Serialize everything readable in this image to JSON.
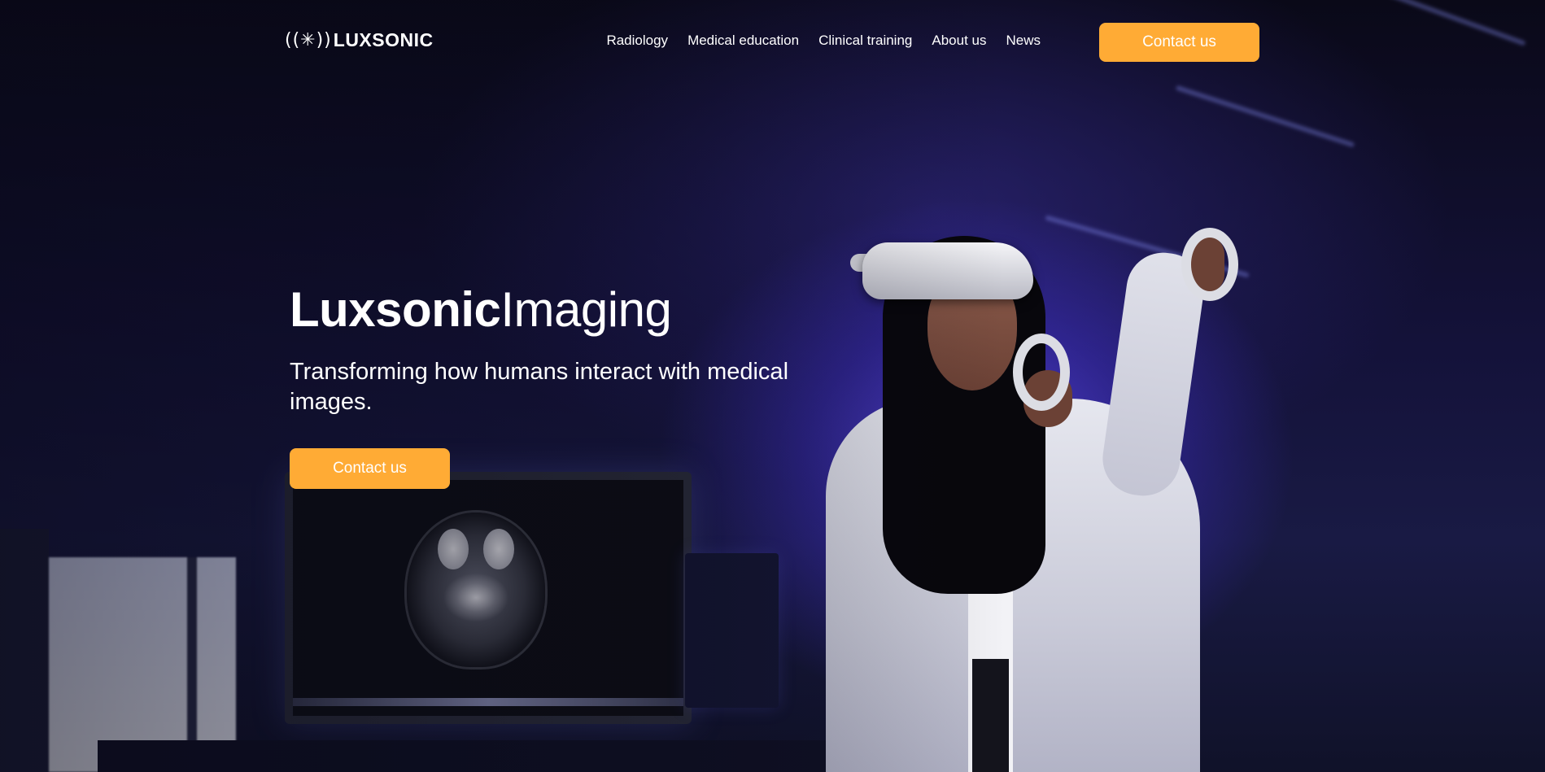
{
  "brand": {
    "logo_mark": "((✳))",
    "logo_text": "LUXSONIC"
  },
  "nav": {
    "items": [
      {
        "label": "Radiology"
      },
      {
        "label": "Medical education"
      },
      {
        "label": "Clinical training"
      },
      {
        "label": "About us"
      },
      {
        "label": "News"
      }
    ],
    "cta_label": "Contact us"
  },
  "hero": {
    "title_strong": "Luxsonic",
    "title_light": "Imaging",
    "subtitle": "Transforming how humans interact with medical images.",
    "cta_label": "Contact us"
  },
  "colors": {
    "accent": "#ffab35",
    "background": "#0b0a1c",
    "text": "#ffffff"
  }
}
